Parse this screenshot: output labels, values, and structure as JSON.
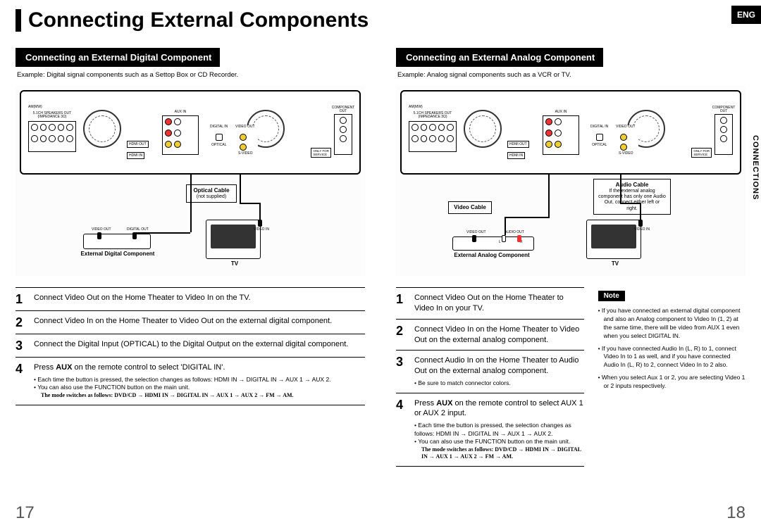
{
  "header": {
    "lang": "ENG",
    "side_section": "CONNECTIONS",
    "title": "Connecting External Components"
  },
  "page_numbers": {
    "left": "17",
    "right": "18"
  },
  "left": {
    "subheading": "Connecting an External Digital Component",
    "example": "Example: Digital signal components such as a Settop Box or CD Recorder.",
    "diagram": {
      "optical_cable": "Optical Cable",
      "optical_cable_note": "(not supplied)",
      "ext_component": "External Digital\nComponent",
      "tv": "TV",
      "video_out": "VIDEO OUT",
      "digital_out": "DIGITAL OUT",
      "video_in": "VIDEO IN"
    },
    "steps": [
      {
        "n": "1",
        "text": "Connect Video Out on the Home Theater to Video In on the TV."
      },
      {
        "n": "2",
        "text": "Connect Video In on the Home Theater to Video Out on the external digital component."
      },
      {
        "n": "3",
        "text": "Connect the Digital Input (OPTICAL) to the Digital Output on the external digital component."
      },
      {
        "n": "4",
        "text_pre": "Press ",
        "text_bold": "AUX",
        "text_post": " on the remote control to select 'DIGITAL IN'.",
        "bullets": [
          "Each time the button is pressed, the selection changes as follows: HDMI IN → DIGITAL IN → AUX 1 → AUX 2.",
          "You can also use the FUNCTION button on the main unit."
        ],
        "nested": "The mode switches as follows: DVD/CD → HDMI IN → DIGITAL IN → AUX 1 → AUX 2 → FM → AM."
      }
    ]
  },
  "right": {
    "subheading": "Connecting an External Analog Component",
    "example": "Example: Analog signal components such as a VCR or TV.",
    "diagram": {
      "video_cable": "Video Cable",
      "audio_cable": "Audio Cable",
      "audio_cable_note": "If the external analog component has only one Audio Out, connect either left or right.",
      "ext_component": "External Analog\nComponent",
      "tv": "TV",
      "video_out": "VIDEO OUT",
      "audio_out": "AUDIO OUT",
      "video_in": "VIDEO IN",
      "l": "L",
      "r": "R"
    },
    "steps": [
      {
        "n": "1",
        "text": "Connect Video Out on the Home Theater to Video In on your TV."
      },
      {
        "n": "2",
        "text": "Connect Video In on the Home Theater to Video Out on the external analog component."
      },
      {
        "n": "3",
        "text": "Connect Audio In on the Home Theater to Audio Out on the external analog component.",
        "bullets": [
          "Be sure to match connector colors."
        ]
      },
      {
        "n": "4",
        "text_pre": "Press ",
        "text_bold": "AUX",
        "text_post": " on the remote control to select AUX 1 or AUX 2 input.",
        "bullets": [
          "Each time the button is pressed, the selection changes as follows: HDMI IN → DIGITAL IN → AUX 1 → AUX 2.",
          "You can also use the FUNCTION button on the main unit."
        ],
        "nested": "The mode switches as follows: DVD/CD → HDMI IN → DIGITAL IN → AUX 1 → AUX 2 → FM → AM."
      }
    ],
    "note": {
      "label": "Note",
      "items": [
        "If you have connected an external digital component and also an Analog component to Video In (1, 2) at the same time, there will be video from AUX 1 even when you select DIGITAL IN.",
        "If you have connected Audio In (L, R) to 1, connect Video In to 1 as well, and if you have connected Audio In (L, R) to 2, connect Video In to 2 also.",
        "When you select Aux 1 or 2, you are selecting Video 1 or 2 inputs respectively."
      ]
    }
  }
}
